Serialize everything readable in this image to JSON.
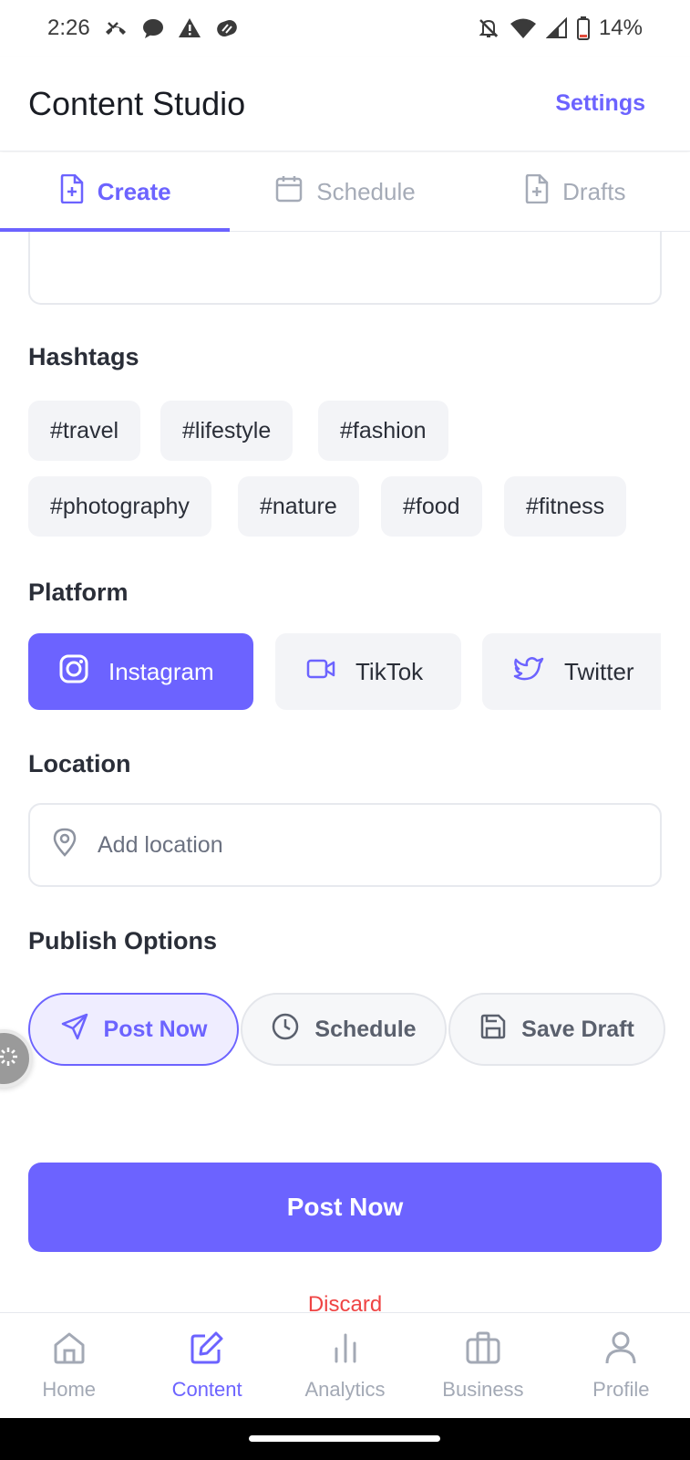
{
  "status_bar": {
    "time": "2:26",
    "battery": "14%"
  },
  "header": {
    "title": "Content Studio",
    "settings_label": "Settings"
  },
  "tabs": [
    {
      "label": "Create",
      "icon": "file-plus-icon",
      "active": true
    },
    {
      "label": "Schedule",
      "icon": "calendar-icon",
      "active": false
    },
    {
      "label": "Drafts",
      "icon": "file-plus-icon",
      "active": false
    }
  ],
  "hashtags": {
    "title": "Hashtags",
    "items": [
      "#travel",
      "#lifestyle",
      "#fashion",
      "#photography",
      "#nature",
      "#food",
      "#fitness"
    ]
  },
  "platform": {
    "title": "Platform",
    "options": [
      {
        "label": "Instagram",
        "icon": "instagram-icon",
        "selected": true
      },
      {
        "label": "TikTok",
        "icon": "video-icon",
        "selected": false
      },
      {
        "label": "Twitter",
        "icon": "twitter-icon",
        "selected": false
      }
    ]
  },
  "location": {
    "title": "Location",
    "placeholder": "Add location"
  },
  "publish_options": {
    "title": "Publish Options",
    "options": [
      {
        "label": "Post Now",
        "icon": "send-icon",
        "selected": true
      },
      {
        "label": "Schedule",
        "icon": "clock-icon",
        "selected": false
      },
      {
        "label": "Save Draft",
        "icon": "save-icon",
        "selected": false
      }
    ]
  },
  "actions": {
    "primary_label": "Post Now",
    "discard_label": "Discard"
  },
  "bottom_nav": [
    {
      "label": "Home",
      "icon": "home-icon",
      "active": false
    },
    {
      "label": "Content",
      "icon": "edit-icon",
      "active": true
    },
    {
      "label": "Analytics",
      "icon": "bar-chart-icon",
      "active": false
    },
    {
      "label": "Business",
      "icon": "briefcase-icon",
      "active": false
    },
    {
      "label": "Profile",
      "icon": "user-icon",
      "active": false
    }
  ],
  "colors": {
    "accent": "#6c63ff",
    "danger": "#ef4444",
    "chip_bg": "#f3f4f7"
  }
}
